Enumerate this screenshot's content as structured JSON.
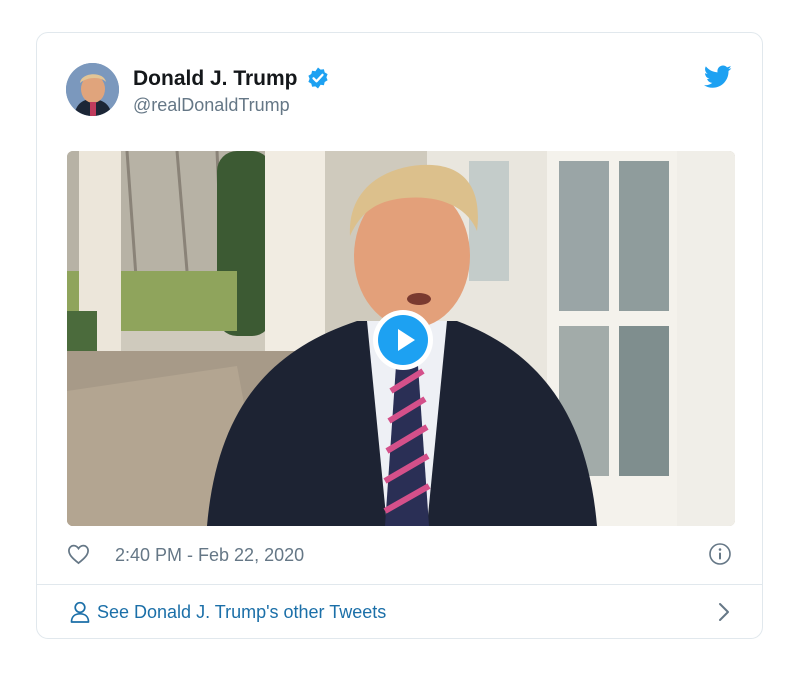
{
  "tweet": {
    "display_name": "Donald J. Trump",
    "handle": "@realDonaldTrump",
    "verified": true,
    "timestamp": "2:40 PM - Feb 22, 2020"
  },
  "footer": {
    "link_label": "See Donald J. Trump's other Tweets"
  },
  "icons": {
    "verified": "verified-badge-icon",
    "brand": "twitter-bird-icon",
    "like": "heart-icon",
    "info": "info-icon",
    "profile": "person-icon",
    "next": "chevron-right-icon",
    "play": "play-icon"
  },
  "colors": {
    "accent": "#1da1f2",
    "link": "#1b6fa8",
    "text_primary": "#14171a",
    "text_secondary": "#657786",
    "border": "#e1e8ed"
  }
}
